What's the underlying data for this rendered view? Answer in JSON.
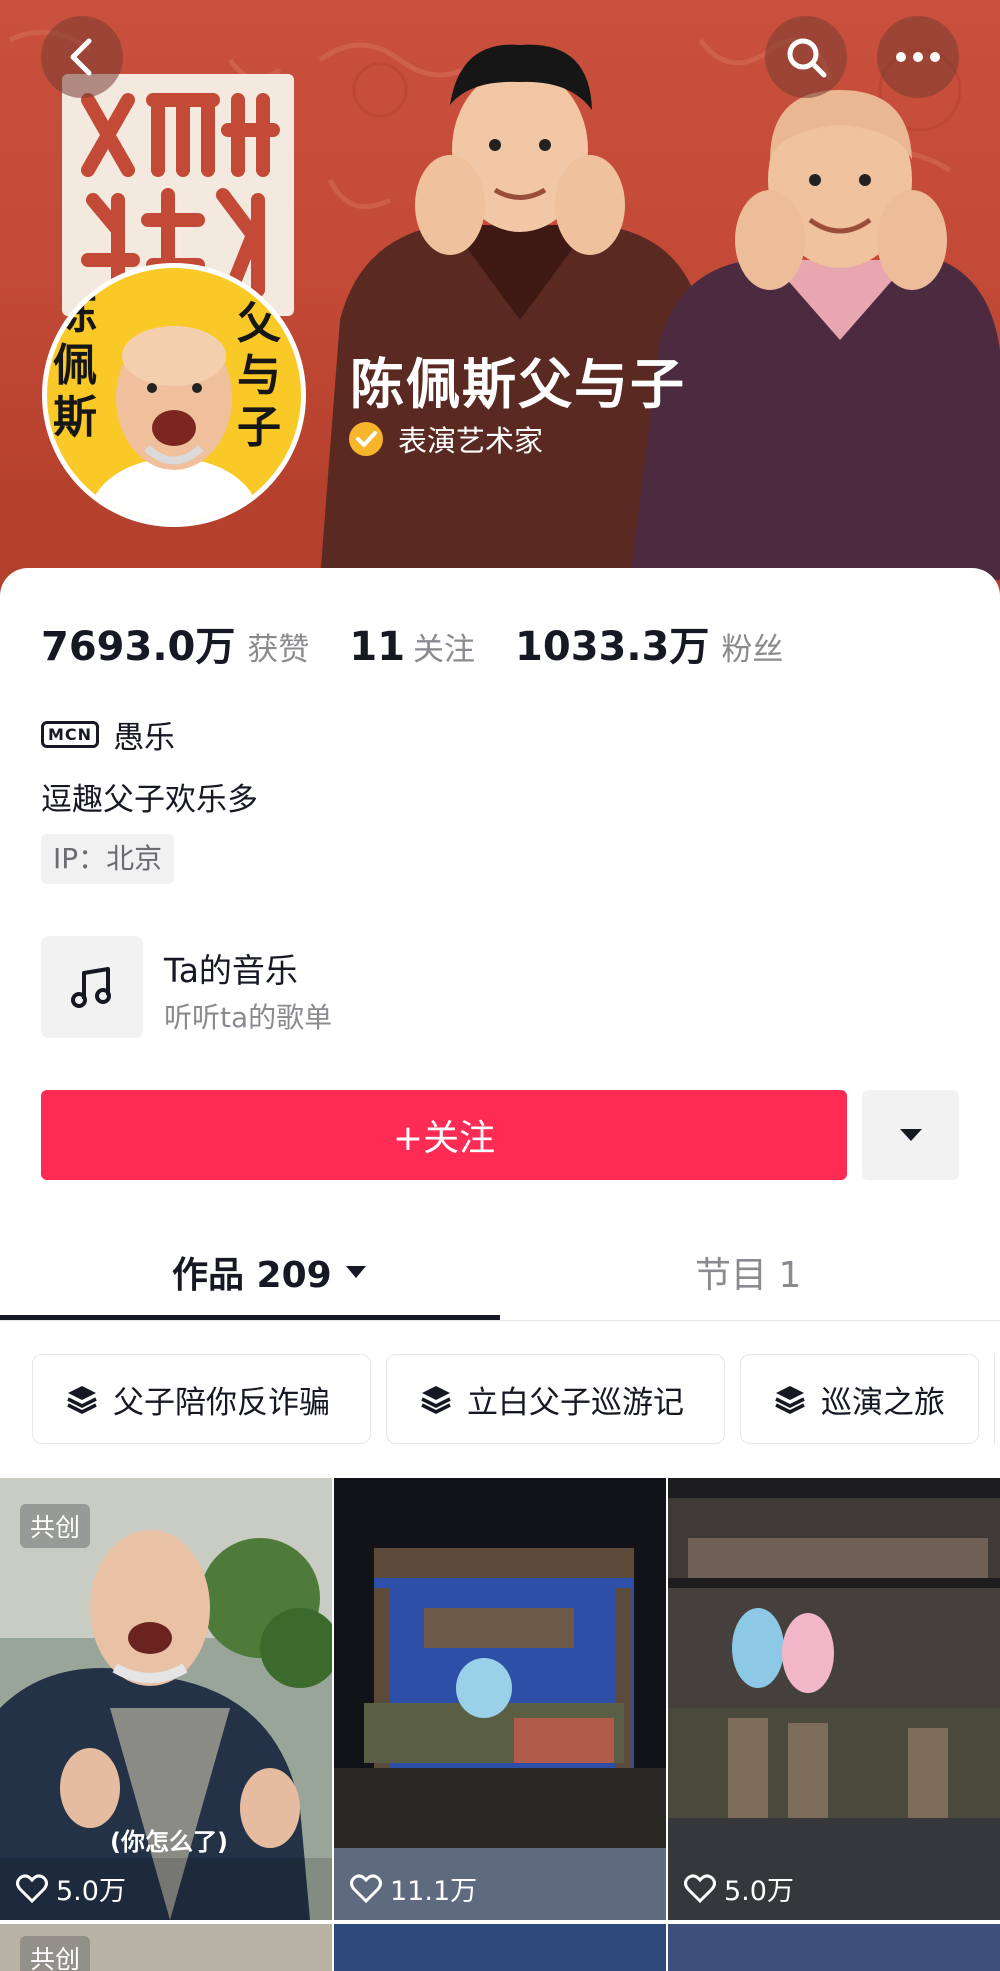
{
  "header": {
    "profile_name": "陈佩斯父与子",
    "verify_label": "表演艺术家",
    "avatar_text_left": "陈佩斯",
    "avatar_text_right": "父与子"
  },
  "stats": {
    "likes_value": "7693.0万",
    "likes_label": "获赞",
    "following_value": "11",
    "following_label": "关注",
    "fans_value": "1033.3万",
    "fans_label": "粉丝"
  },
  "profile": {
    "mcn_badge": "MCN",
    "mcn_name": "愚乐",
    "bio": "逗趣父子欢乐多",
    "ip_location": "IP：北京"
  },
  "music": {
    "title": "Ta的音乐",
    "subtitle": "听听ta的歌单"
  },
  "actions": {
    "follow_label": "+关注"
  },
  "tabs": [
    {
      "label": "作品 209",
      "active": true
    },
    {
      "label": "节目 1",
      "active": false
    }
  ],
  "collections": [
    {
      "label": "父子陪你反诈骗"
    },
    {
      "label": "立白父子巡游记"
    },
    {
      "label": "巡演之旅"
    }
  ],
  "videos": [
    {
      "badge": "共创",
      "caption": "(你怎么了)",
      "likes": "5.0万"
    },
    {
      "badge": "",
      "caption": "",
      "likes": "11.1万"
    },
    {
      "badge": "",
      "caption": "",
      "likes": "5.0万"
    }
  ],
  "next_row": [
    {
      "badge": "共创"
    }
  ],
  "colors": {
    "accent": "#fe2c55",
    "banner": "#c24a36",
    "verify": "#f6b52a"
  }
}
